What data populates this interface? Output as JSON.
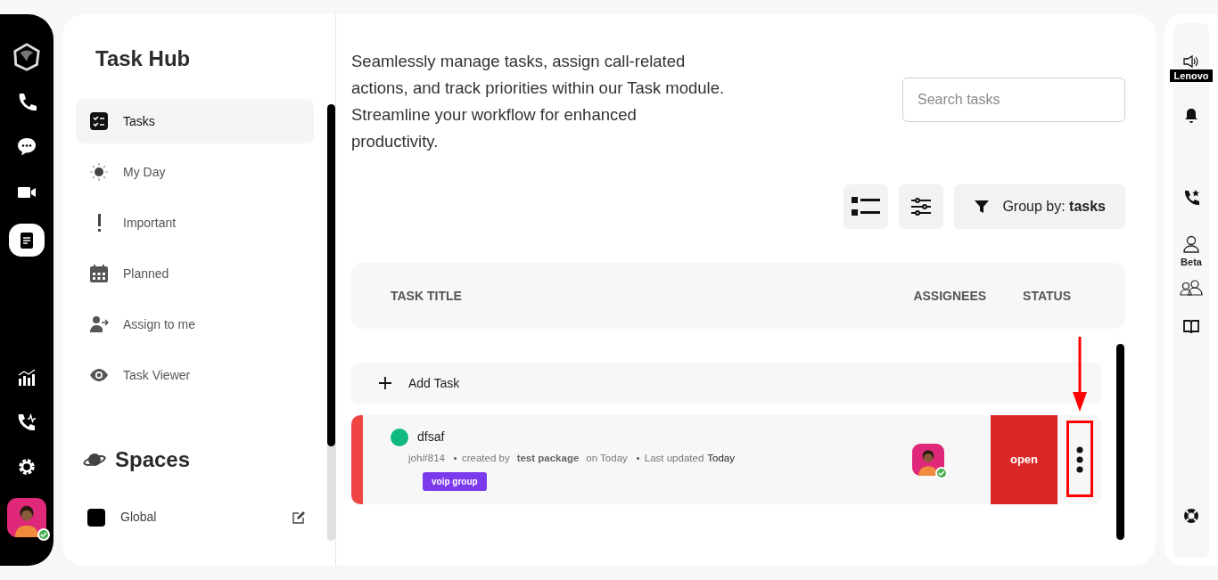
{
  "app_rail": {
    "items": [
      {
        "kind": "phone",
        "selected": false
      },
      {
        "kind": "chat",
        "selected": false
      },
      {
        "kind": "video",
        "selected": false
      },
      {
        "kind": "notes",
        "selected": true
      },
      {
        "kind": "stats",
        "selected": false
      },
      {
        "kind": "call-activity",
        "selected": false
      },
      {
        "kind": "settings",
        "selected": false
      }
    ],
    "user_online": true
  },
  "sidebar": {
    "title": "Task Hub",
    "items": [
      {
        "label": "Tasks",
        "kind": "tasks",
        "selected": true
      },
      {
        "label": "My Day",
        "kind": "sun",
        "selected": false
      },
      {
        "label": "Important",
        "kind": "exclaim",
        "selected": false
      },
      {
        "label": "Planned",
        "kind": "calendar",
        "selected": false
      },
      {
        "label": "Assign to me",
        "kind": "assign",
        "selected": false
      },
      {
        "label": "Task Viewer",
        "kind": "eye",
        "selected": false
      }
    ],
    "spaces_title": "Spaces",
    "spaces": [
      {
        "label": "Global",
        "color": "#000000"
      }
    ]
  },
  "description": "Seamlessly manage tasks, assign call-related actions, and track priorities within our Task module. Streamline your workflow for enhanced productivity.",
  "search": {
    "placeholder": "Search tasks"
  },
  "toolbar": {
    "group_by": "Group by: **tasks**"
  },
  "table": {
    "columns": [
      "TASK TITLE",
      "ASSIGNEES",
      "STATUS"
    ],
    "add_task": "Add Task",
    "rows": [
      {
        "title": "dfsaf",
        "color": "#10b981",
        "id": "joh#814",
        "created_by_label": "created by",
        "created_by": "test package",
        "created_on": "on Today",
        "updated_label": "Last updated",
        "updated": "Today",
        "tag": "voip group",
        "assignee_online": true,
        "status": "open",
        "highlighted_menu": true
      }
    ]
  },
  "right_rail": {
    "device": "Lenovo",
    "beta_label": "Beta"
  }
}
